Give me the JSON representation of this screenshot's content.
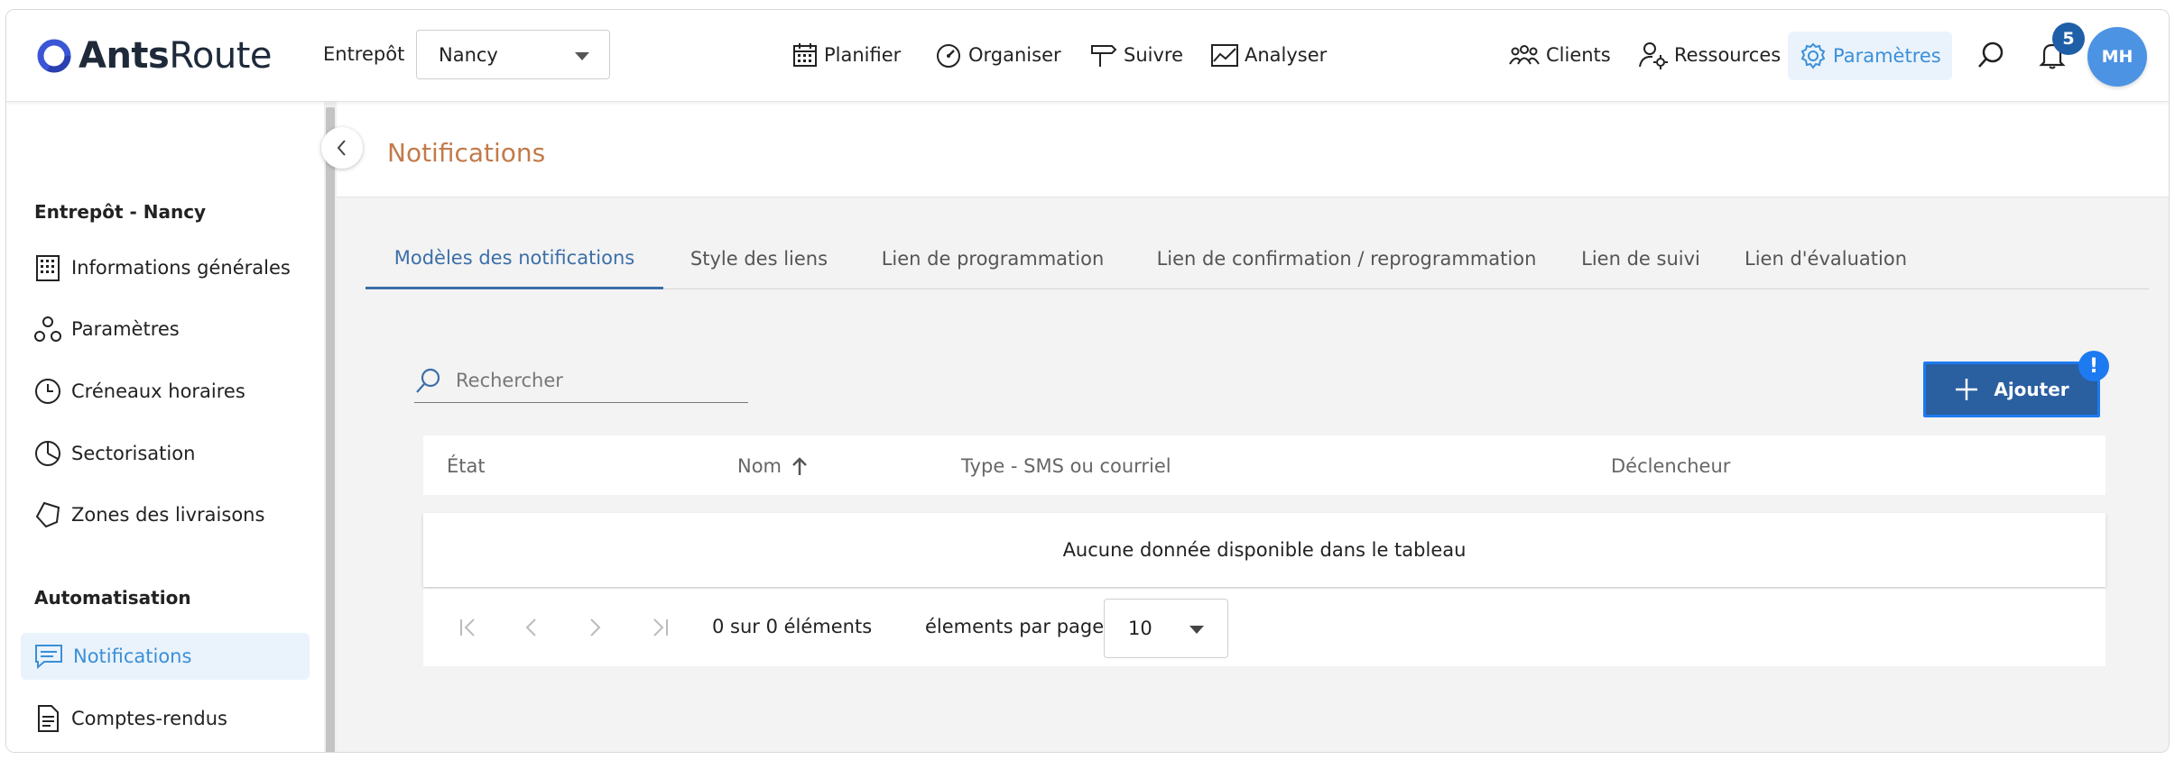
{
  "app": {
    "logo_bold": "Ants",
    "logo_light": "Route"
  },
  "header": {
    "warehouse_label": "Entrepôt",
    "warehouse_value": "Nancy",
    "nav": [
      {
        "label": "Planifier",
        "icon": "calendar-icon"
      },
      {
        "label": "Organiser",
        "icon": "dashboard-gauge-icon"
      },
      {
        "label": "Suivre",
        "icon": "signpost-icon"
      },
      {
        "label": "Analyser",
        "icon": "chart-icon"
      }
    ],
    "right_nav": [
      {
        "label": "Clients",
        "icon": "users-group-icon"
      },
      {
        "label": "Ressources",
        "icon": "user-gear-icon"
      },
      {
        "label": "Paramètres",
        "icon": "gear-icon",
        "active": true
      }
    ],
    "notification_count": "5",
    "avatar_initials": "MH"
  },
  "sidebar": {
    "section1": "Entrepôt - Nancy",
    "items": [
      {
        "label": "Informations générales",
        "icon": "building-icon"
      },
      {
        "label": "Paramètres",
        "icon": "network-icon"
      },
      {
        "label": "Créneaux horaires",
        "icon": "clock-icon"
      },
      {
        "label": "Sectorisation",
        "icon": "pie-chart-icon"
      },
      {
        "label": "Zones des livraisons",
        "icon": "polygon-icon"
      }
    ],
    "section2": "Automatisation",
    "items2": [
      {
        "label": "Notifications",
        "icon": "message-icon",
        "active": true
      },
      {
        "label": "Comptes-rendus",
        "icon": "document-icon"
      }
    ]
  },
  "main": {
    "page_title": "Notifications",
    "tabs": [
      {
        "label": "Modèles des notifications",
        "active": true
      },
      {
        "label": "Style des liens"
      },
      {
        "label": "Lien de programmation"
      },
      {
        "label": "Lien de confirmation / reprogrammation"
      },
      {
        "label": "Lien de suivi"
      },
      {
        "label": "Lien d'évaluation"
      }
    ],
    "search_placeholder": "Rechercher",
    "add_label": "Ajouter",
    "warning_badge": "!",
    "columns": [
      "État",
      "Nom",
      "Type - SMS ou courriel",
      "Déclencheur"
    ],
    "empty_message": "Aucune donnée disponible dans le tableau",
    "pager": {
      "count_text": "0 sur 0 éléments",
      "per_page_label": "élements par page",
      "per_page_value": "10"
    }
  },
  "colors": {
    "accent": "#3b8fd9",
    "primary_button": "#2a5fa0",
    "title": "#c27a4a",
    "avatar": "#4d93e3",
    "badge": "#1f5fa8"
  }
}
